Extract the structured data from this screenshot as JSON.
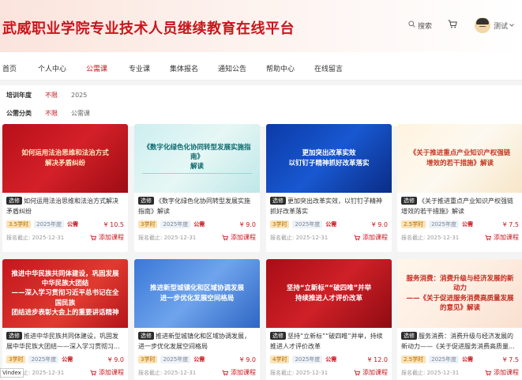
{
  "header": {
    "site_title": "武威职业学院专业技术人员继续教育在线平台",
    "search_label": "搜索",
    "user_name": "测试",
    "brand_color": "#c8161d"
  },
  "nav": {
    "items": [
      {
        "label": "首页",
        "active": false
      },
      {
        "label": "个人中心",
        "active": false
      },
      {
        "label": "公需课",
        "active": true
      },
      {
        "label": "专业课",
        "active": false
      },
      {
        "label": "集体报名",
        "active": false
      },
      {
        "label": "通知公告",
        "active": false
      },
      {
        "label": "帮助中心",
        "active": false
      },
      {
        "label": "在线留言",
        "active": false
      }
    ]
  },
  "filters": {
    "year": {
      "label": "培训年度",
      "options": [
        {
          "label": "不限",
          "active": true
        },
        {
          "label": "2025",
          "active": false
        }
      ]
    },
    "category": {
      "label": "公需分类",
      "options": [
        {
          "label": "不限",
          "active": true
        },
        {
          "label": "公需课",
          "active": false
        }
      ]
    }
  },
  "courses": [
    {
      "cover": "如何运用法治思维和法治方式\n解决矛盾纠纷",
      "theme": "red",
      "tag": "选修",
      "title": "如何运用法治思维和法治方式解决矛盾纠纷",
      "hours": "3.5学时",
      "year": "2025年度",
      "kind": "公需",
      "price": "¥ 10.5",
      "deadline": "报名截止: 2025-12-31",
      "add_label": "添加课程"
    },
    {
      "cover": "《数字化绿色化协同转型发展实施指南》\n解读",
      "theme": "teal",
      "tag": "选修",
      "title": "《数字化绿色化协同转型发展实施指南》解读",
      "hours": "3学时",
      "year": "2025年度",
      "kind": "公需",
      "price": "¥ 9.0",
      "deadline": "报名截止: 2025-12-31",
      "add_label": "添加课程"
    },
    {
      "cover": "更加突出改革实效\n以钉钉子精神抓好改革落实",
      "theme": "blue",
      "tag": "选修",
      "title": "更加突出改革实效，以钉钉子精神抓好改革落实",
      "hours": "3学时",
      "year": "2025年度",
      "kind": "公需",
      "price": "¥ 9.0",
      "deadline": "报名截止: 2025-12-31",
      "add_label": "添加课程"
    },
    {
      "cover": "《关于推进重点产业知识产权强链\n增效的若干措施》解读",
      "theme": "cream",
      "tag": "选修",
      "title": "《关于推进重点产业知识产权强链增效的若干措施》解读",
      "hours": "2.5学时",
      "year": "2025年度",
      "kind": "公需",
      "price": "¥ 7.5",
      "deadline": "报名截止: 2025-12-31",
      "add_label": "添加课程"
    },
    {
      "cover": "推进中华民族共同体建设，巩固发展\n中华民族大团结\n——深入学习贯彻习近平总书记在全国民族\n团结进步表彰大会上的重要讲话精神",
      "theme": "red2",
      "tag": "选修",
      "title": "推进中华民族共同体建设，巩固发展中华民族大团结——深入学习贯彻习...",
      "hours": "3学时",
      "year": "2025年度",
      "kind": "公需",
      "price": "¥ 9.0",
      "deadline": "报名截止: 2025-12-31",
      "add_label": "添加课程"
    },
    {
      "cover": "推进新型城镇化和区域协调发展\n进一步优化发展空间格局",
      "theme": "blue2",
      "tag": "选修",
      "title": "推进新型城镇化和区域协调发展，进一步优化发展空间格局",
      "hours": "3学时",
      "year": "2025年度",
      "kind": "公需",
      "price": "¥ 9.0",
      "deadline": "报名截止: 2025-12-31",
      "add_label": "添加课程"
    },
    {
      "cover": "坚持“立新标”“破四唯”并举\n持续推进人才评价改革",
      "theme": "red3",
      "tag": "选修",
      "title": "坚持“立新标”“破四唯”并举，持续推进人才评价改革",
      "hours": "4学时",
      "year": "2025年度",
      "kind": "公需",
      "price": "¥ 12.0",
      "deadline": "报名截止: 2025-12-31",
      "add_label": "添加课程"
    },
    {
      "cover": "服务消费：消费升级与经济发展的新动力\n——《关于促进服务消费高质量发展\n的意见》解读",
      "theme": "cream2",
      "tag": "选修",
      "title": "服务消费：消费升级与经济发展的新动力——《关于促进服务消费高质量...",
      "hours": "2.5学时",
      "year": "2025年度",
      "kind": "公需",
      "price": "¥ 7.5",
      "deadline": "报名截止: 2025-12-31",
      "add_label": "添加课程"
    }
  ],
  "status_bar": "Vindex"
}
